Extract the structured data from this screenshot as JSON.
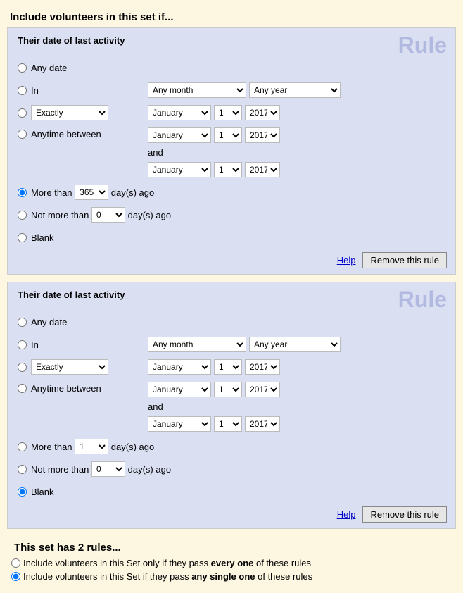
{
  "header": "Include volunteers in this set if...",
  "watermark": "Rule",
  "and_label": "and",
  "days_ago_suffix": "day(s) ago",
  "help_label": "Help",
  "remove_label": "Remove this rule",
  "options": {
    "any_date": "Any date",
    "in": "In",
    "exactly": "Exactly",
    "anytime_between": "Anytime between",
    "more_than": "More than",
    "not_more_than": "Not more than",
    "blank": "Blank"
  },
  "selects": {
    "any_month": "Any month",
    "any_year": "Any year",
    "january": "January",
    "day1": "1",
    "year2017": "2017",
    "num0": "0",
    "num1": "1",
    "num365": "365"
  },
  "rules": [
    {
      "title": "Their date of last activity",
      "selected": "more_than",
      "more_than_value": "365",
      "not_more_than_value": "0"
    },
    {
      "title": "Their date of last activity",
      "selected": "blank",
      "more_than_value": "1",
      "not_more_than_value": "0"
    }
  ],
  "summary": {
    "title": "This set has 2 rules...",
    "every_pre": "Include volunteers in this Set only if they pass ",
    "every_bold": "every one",
    "every_post": " of these rules",
    "any_pre": "Include volunteers in this Set if they pass ",
    "any_bold": "any single one",
    "any_post": " of these rules",
    "selected": "any"
  }
}
